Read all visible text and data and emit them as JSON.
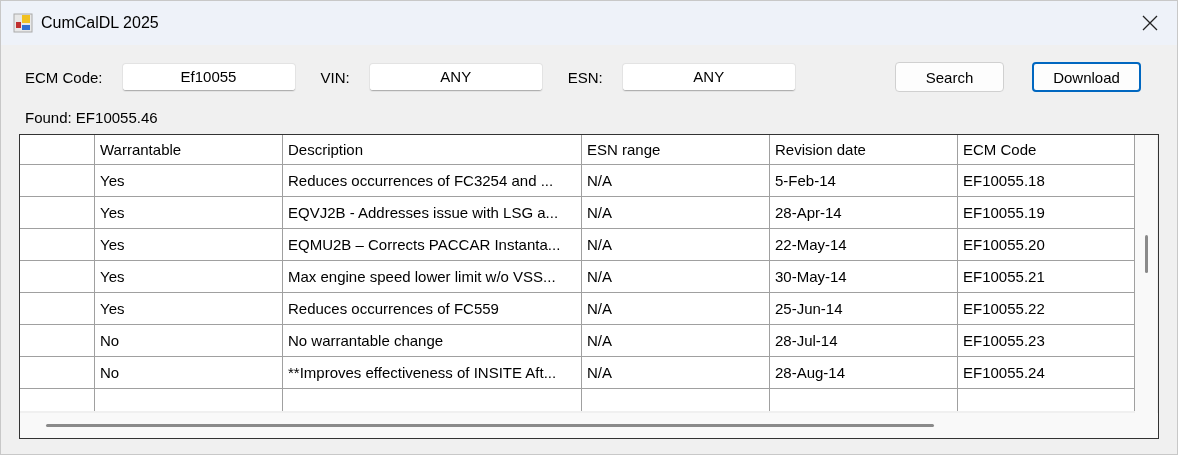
{
  "window": {
    "title": "CumCalDL 2025"
  },
  "filters": [
    {
      "label": "ECM Code:",
      "value": "Ef10055"
    },
    {
      "label": "VIN:",
      "value": "ANY"
    },
    {
      "label": "ESN:",
      "value": "ANY"
    }
  ],
  "buttons": [
    {
      "label": "Search",
      "focused": false
    },
    {
      "label": "Download",
      "focused": true
    }
  ],
  "found": "Found: EF10055.46",
  "table": {
    "columns": [
      "Warrantable",
      "Description",
      "ESN range",
      "Revision date",
      "ECM Code"
    ],
    "rows": [
      [
        "Yes",
        "Reduces occurrences of FC3254 and ...",
        "N/A",
        "5-Feb-14",
        "EF10055.18"
      ],
      [
        "Yes",
        "EQVJ2B - Addresses issue with LSG a...",
        "N/A",
        "28-Apr-14",
        "EF10055.19"
      ],
      [
        "Yes",
        "EQMU2B – Corrects PACCAR Instanta...",
        "N/A",
        "22-May-14",
        "EF10055.20"
      ],
      [
        "Yes",
        "Max engine speed lower limit w/o VSS...",
        "N/A",
        "30-May-14",
        "EF10055.21"
      ],
      [
        "Yes",
        "Reduces occurrences of FC559",
        "N/A",
        "25-Jun-14",
        "EF10055.22"
      ],
      [
        "No",
        "No warrantable change",
        "N/A",
        "28-Jul-14",
        "EF10055.23"
      ],
      [
        "No",
        "**Improves effectiveness of INSITE Aft...",
        "N/A",
        "28-Aug-14",
        "EF10055.24"
      ]
    ]
  }
}
